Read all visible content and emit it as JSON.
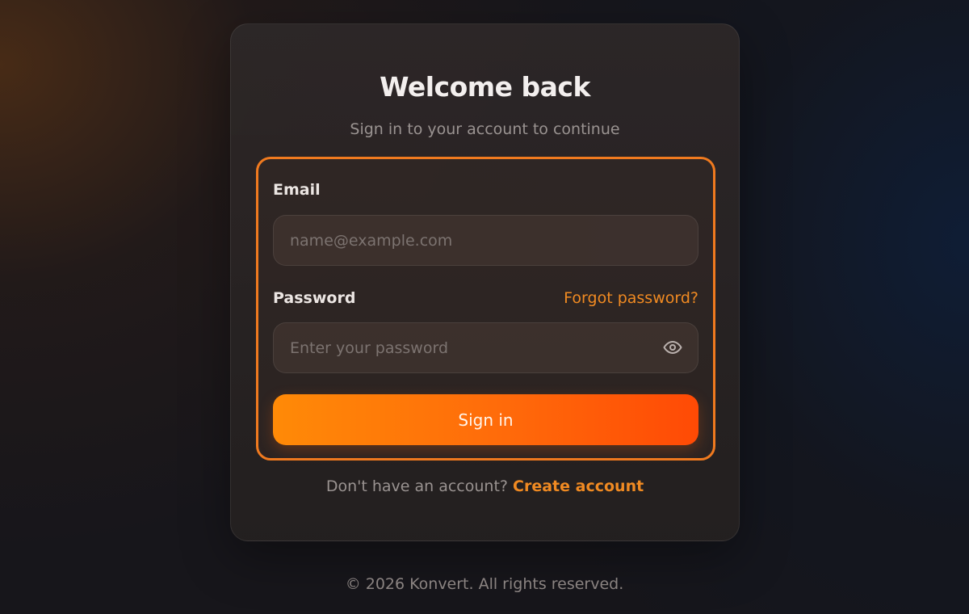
{
  "card": {
    "title": "Welcome back",
    "subtitle": "Sign in to your account to continue"
  },
  "form": {
    "email_label": "Email",
    "email_placeholder": "name@example.com",
    "email_value": "",
    "password_label": "Password",
    "forgot_password_link": "Forgot password?",
    "password_placeholder": "Enter your password",
    "password_value": "",
    "password_toggle_icon": "eye-icon",
    "submit_label": "Sign in"
  },
  "signup": {
    "prompt": "Don't have an account?",
    "link": "Create account"
  },
  "footer": {
    "text": "© 2026 Konvert. All rights reserved."
  },
  "colors": {
    "accent": "#f08a22",
    "focus_outline": "#f07a1f",
    "button_gradient_start": "#ff8a07",
    "button_gradient_end": "#ff4a05"
  }
}
